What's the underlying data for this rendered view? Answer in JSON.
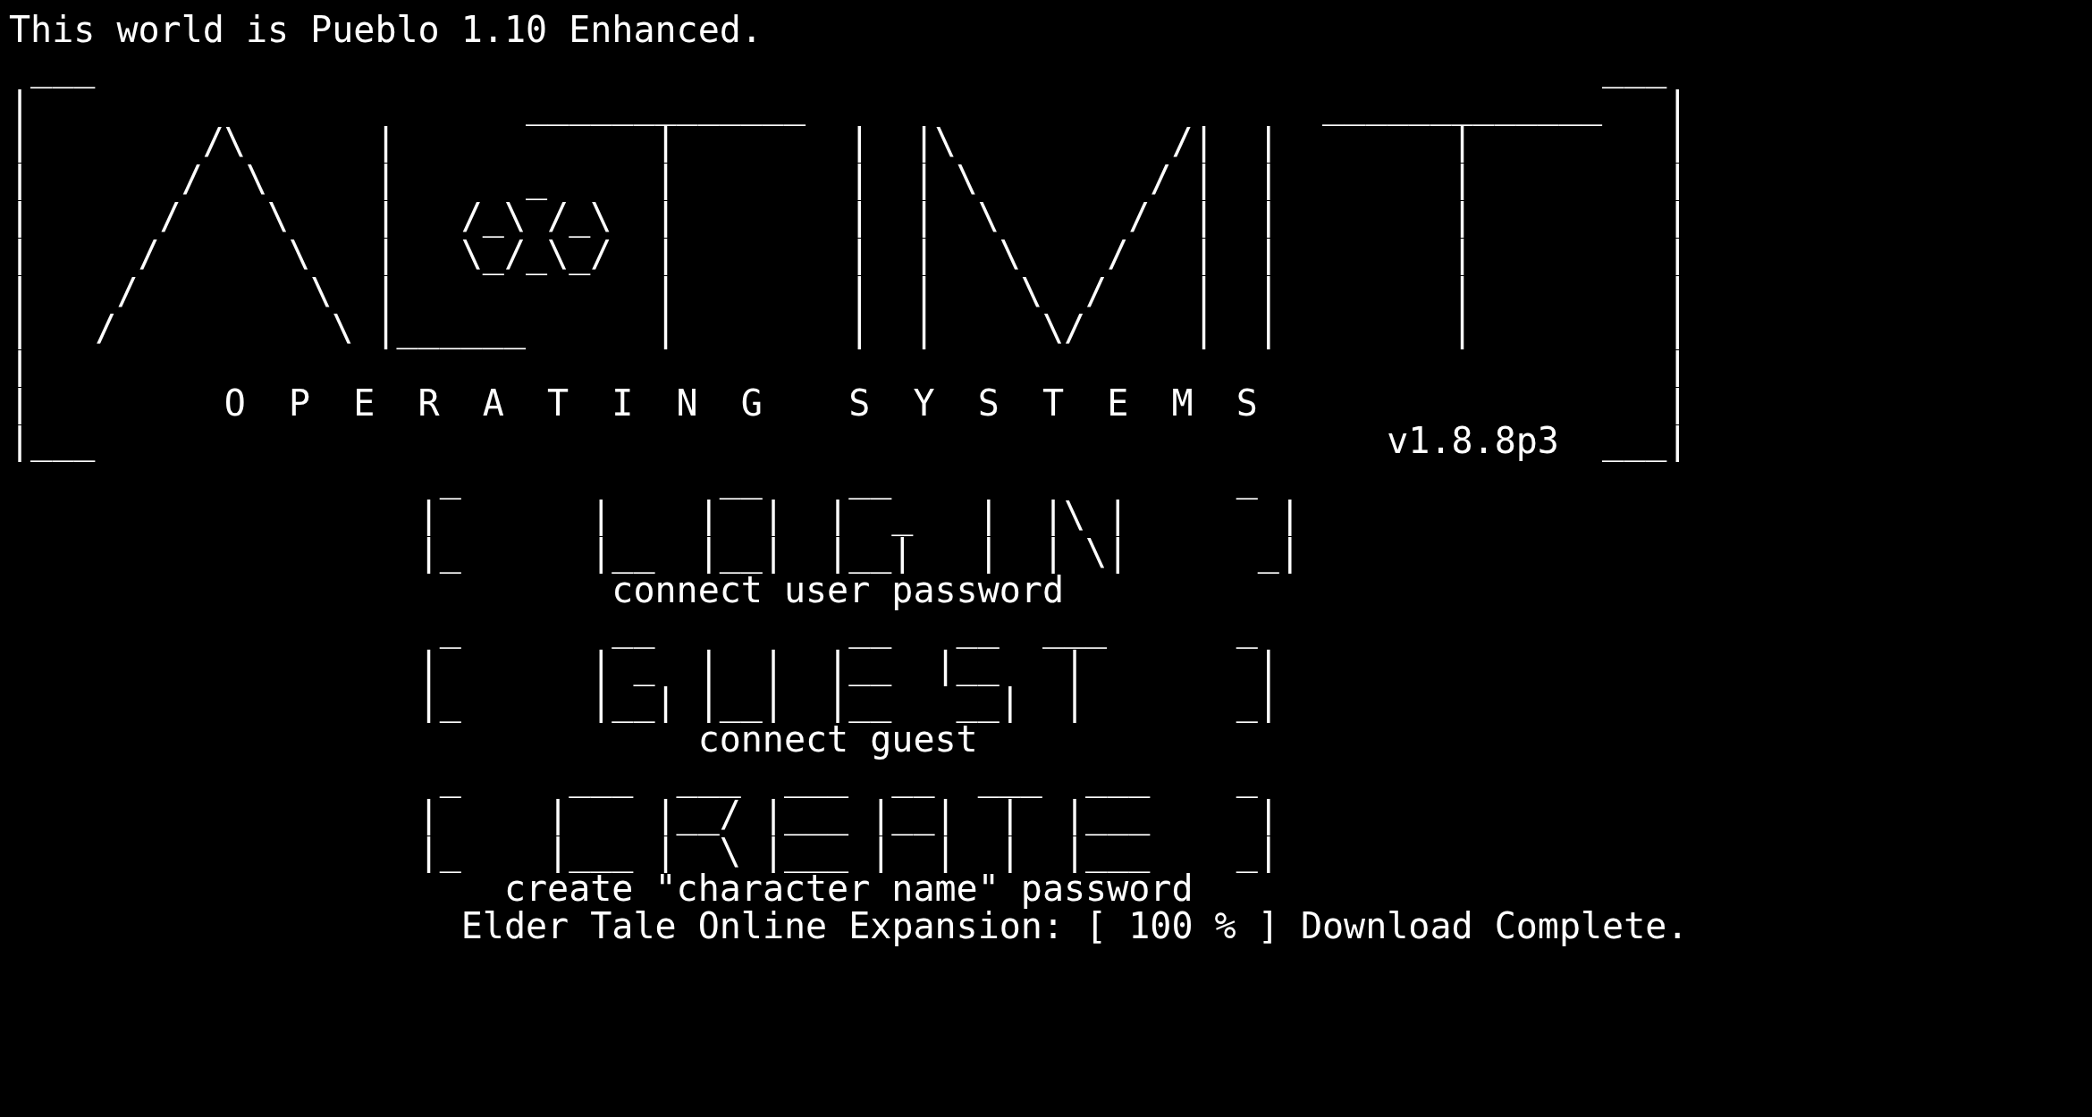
{
  "terminal": {
    "blocks": [
      {
        "kind": "text",
        "text": "This world is Pueblo 1.10 Enhanced."
      },
      {
        "kind": "art",
        "lines": [
          " ___                                                                      ___",
          "|                       _____________                        _____________   |",
          "|        /\\      |            |        |  |\\          /|  |        |         |",
          "|       /  \\     |      _     |        |  | \\        / |  |        |         |",
          "|      /    \\    |   /_\\ /_\\  |        |  |  \\      /  |  |        |         |",
          "|     /      \\   |   \\_/_\\_/  |        |  |   \\    /   |  |        |         |",
          "|    /        \\  |            |        |  |    \\  /    |  |        |         |",
          "|   /          \\ |______      |        |  |     \\/     |  |        |         |",
          "|                                                                            |",
          "|         O  P  E  R  A  T  I  N  G    S  Y  S  T  E  M  S                   |",
          "|___                                                            v1.8.8p3  ___|"
        ]
      },
      {
        "kind": "art",
        "lines": [
          "                    _            __    __                _",
          "                   |       |    |  |  |  _   |  |\\ |       |",
          "                   |_      |__  |__|  |__|   |  | \\|      _|"
        ]
      },
      {
        "kind": "text",
        "text": "                            connect user password"
      },
      {
        "kind": "art",
        "lines": [
          "                    _       __         __   __  ___      _",
          "                   |       | _  |  |  |__  |__   |        |",
          "                   |_      |__| |__|  |__   __|  |       _|"
        ]
      },
      {
        "kind": "text",
        "text": "                                connect guest"
      },
      {
        "kind": "art",
        "lines": [
          "                    _     ___  ___  ___  __  ___  ___    _",
          "                   |     |    |__/ |___ |__|  |  |___     |",
          "                   |_    |___ |  \\ |___ |  |  |  |___    _|"
        ]
      },
      {
        "kind": "text",
        "text": "                       create \"character name\" password"
      },
      {
        "kind": "text",
        "text": "                     Elder Tale Online Expansion: [ 100 % ] Download Complete."
      }
    ]
  }
}
